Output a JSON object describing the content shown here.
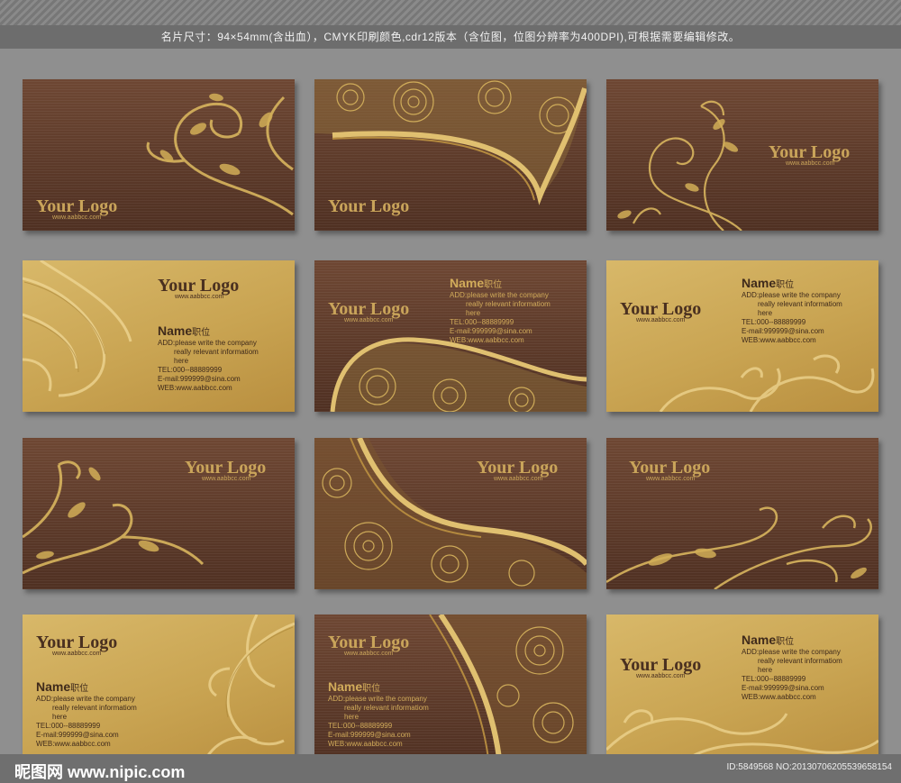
{
  "header_text": "名片尺寸：94×54mm(含出血），CMYK印刷颜色,cdr12版本（含位图，位图分辨率为400DPI),可根据需要编辑修改。",
  "colors": {
    "dark_bg": "#5a3727",
    "gold_bg": "#c9a452",
    "gold_text": "#c9a45a",
    "brown_text": "#4a3020"
  },
  "cards": [
    {
      "theme": "dark",
      "logo": "Your Logo",
      "url": "www.aabbcc.com"
    },
    {
      "theme": "dark",
      "logo": "Your Logo"
    },
    {
      "theme": "dark",
      "logo": "Your Logo",
      "url": "www.aabbcc.com"
    },
    {
      "theme": "gold",
      "logo": "Your Logo",
      "url": "www.aabbcc.com"
    },
    {
      "theme": "dark",
      "logo": "Your Logo",
      "url": "www.aabbcc.com"
    },
    {
      "theme": "gold",
      "logo": "Your Logo",
      "url": "www.aabbcc.com"
    },
    {
      "theme": "dark",
      "logo": "Your Logo",
      "url": "www.aabbcc.com"
    },
    {
      "theme": "dark",
      "logo": "Your Logo",
      "url": "www.aabbcc.com"
    },
    {
      "theme": "dark",
      "logo": "Your Logo",
      "url": "www.aabbcc.com"
    },
    {
      "theme": "gold",
      "logo": "Your Logo",
      "url": "www.aabbcc.com"
    },
    {
      "theme": "dark",
      "logo": "Your Logo",
      "url": "www.aabbcc.com"
    },
    {
      "theme": "gold",
      "logo": "Your Logo",
      "url": "www.aabbcc.com"
    }
  ],
  "contact": {
    "name": "Name",
    "title": "职位",
    "address_line1": "ADD:please write the company",
    "address_line2": "really relevant informatiom",
    "address_line3": "here",
    "tel": "TEL:000--88889999",
    "email": "E-mail:999999@sina.com",
    "web": "WEB:www.aabbcc.com"
  },
  "footer": {
    "watermark": "昵图网 www.nipic.com",
    "image_id": "ID:5849568 NO:20130706205539658154"
  }
}
